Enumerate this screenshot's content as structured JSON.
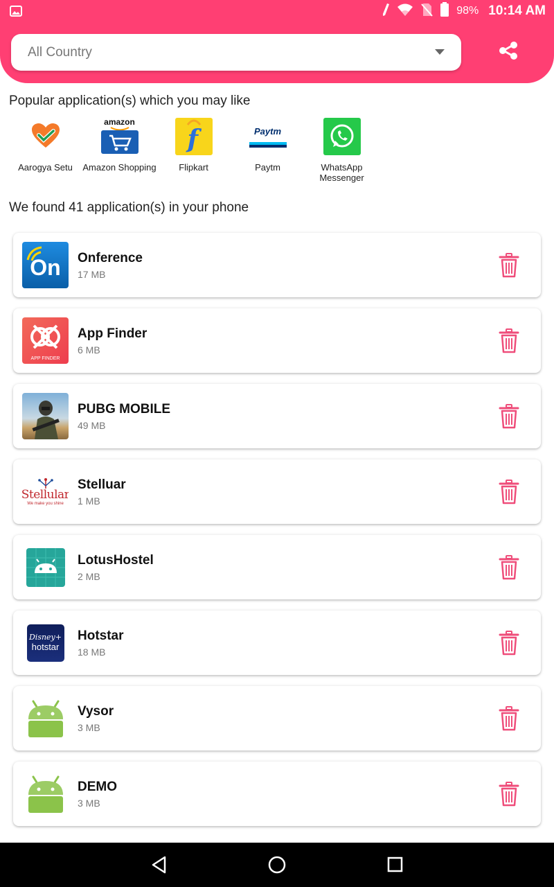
{
  "status_bar": {
    "battery_percent": "98%",
    "time": "10:14 AM"
  },
  "country_select": {
    "value": "All Country"
  },
  "popular": {
    "title": "Popular application(s) which you may like",
    "apps": [
      {
        "name": "Aarogya Setu",
        "icon": "aarogya-setu-icon"
      },
      {
        "name": "Amazon Shopping",
        "icon": "amazon-shopping-icon",
        "icon_text": "amazon"
      },
      {
        "name": "Flipkart",
        "icon": "flipkart-icon",
        "icon_text": "f"
      },
      {
        "name": "Paytm",
        "icon": "paytm-icon",
        "icon_text": "Paytm"
      },
      {
        "name": "WhatsApp Messenger",
        "icon": "whatsapp-icon"
      }
    ]
  },
  "found_text": "We found 41 application(s) in your phone",
  "apps": [
    {
      "name": "Onference",
      "size": "17 MB",
      "icon": "onference-icon",
      "icon_text": "On"
    },
    {
      "name": "App Finder",
      "size": "6 MB",
      "icon": "app-finder-icon",
      "icon_text": "APP FINDER"
    },
    {
      "name": "PUBG MOBILE",
      "size": "49 MB",
      "icon": "pubg-icon"
    },
    {
      "name": "Stelluar",
      "size": "1 MB",
      "icon": "stellular-icon",
      "icon_text": "Stellular",
      "icon_subtext": "We make you shine"
    },
    {
      "name": "LotusHostel",
      "size": "2 MB",
      "icon": "android-icon"
    },
    {
      "name": "Hotstar",
      "size": "18 MB",
      "icon": "hotstar-icon",
      "icon_text": "Disney+",
      "icon_subtext": "hotstar"
    },
    {
      "name": "Vysor",
      "size": "3 MB",
      "icon": "android-icon"
    },
    {
      "name": "DEMO",
      "size": "3 MB",
      "icon": "android-icon"
    }
  ],
  "colors": {
    "accent": "#ff3f73",
    "delete": "#ef4d7a"
  }
}
